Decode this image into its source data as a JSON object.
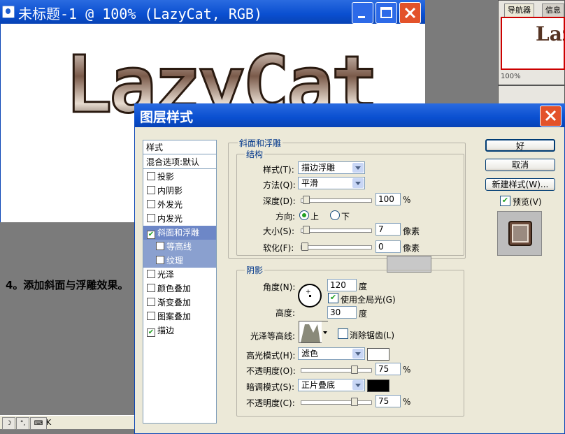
{
  "doc_window": {
    "title": "未标题-1 @ 100% (LazyCat, RGB)",
    "canvas_text": "LazyCat"
  },
  "nav_panel": {
    "tabs": [
      "导航器",
      "信息"
    ],
    "thumb_text": "Laz",
    "zoom": "100%"
  },
  "step_text": "4。添加斜面与浮雕效果。",
  "status_text": "K",
  "dialog": {
    "title": "图层样式",
    "style_list": {
      "header": "样式",
      "blend_options": "混合选项:默认",
      "items": [
        {
          "label": "投影",
          "checked": false
        },
        {
          "label": "内阴影",
          "checked": false
        },
        {
          "label": "外发光",
          "checked": false
        },
        {
          "label": "内发光",
          "checked": false
        },
        {
          "label": "斜面和浮雕",
          "checked": true,
          "selected": true
        },
        {
          "label": "等高线",
          "checked": false,
          "sub": true
        },
        {
          "label": "纹理",
          "checked": false,
          "sub": true
        },
        {
          "label": "光泽",
          "checked": false
        },
        {
          "label": "颜色叠加",
          "checked": false
        },
        {
          "label": "渐变叠加",
          "checked": false
        },
        {
          "label": "图案叠加",
          "checked": false
        },
        {
          "label": "描边",
          "checked": true
        }
      ]
    },
    "bevel": {
      "section_title": "斜面和浮雕",
      "structure_title": "结构",
      "style_label": "样式(T):",
      "style_value": "描边浮雕",
      "technique_label": "方法(Q):",
      "technique_value": "平滑",
      "depth_label": "深度(D):",
      "depth_value": "100",
      "depth_unit": "%",
      "direction_label": "方向:",
      "direction_up": "上",
      "direction_down": "下",
      "size_label": "大小(S):",
      "size_value": "7",
      "size_unit": "像素",
      "soften_label": "软化(F):",
      "soften_value": "0",
      "soften_unit": "像素"
    },
    "shading": {
      "title": "阴影",
      "angle_label": "角度(N):",
      "angle_value": "120",
      "angle_unit": "度",
      "global_light_label": "使用全局光(G)",
      "altitude_label": "高度:",
      "altitude_value": "30",
      "altitude_unit": "度",
      "gloss_label": "光泽等高线:",
      "antialias_label": "消除锯齿(L)",
      "highlight_label": "高光模式(H):",
      "highlight_value": "滤色",
      "highlight_color": "#ffffff",
      "opacity1_label": "不透明度(O):",
      "opacity1_value": "75",
      "opacity_unit": "%",
      "shadow_label": "暗调模式(S):",
      "shadow_value": "正片叠底",
      "shadow_color": "#000000",
      "opacity2_label": "不透明度(C):",
      "opacity2_value": "75"
    },
    "buttons": {
      "ok": "好",
      "cancel": "取消",
      "new_style": "新建样式(W)...",
      "preview": "预览(V)"
    }
  }
}
